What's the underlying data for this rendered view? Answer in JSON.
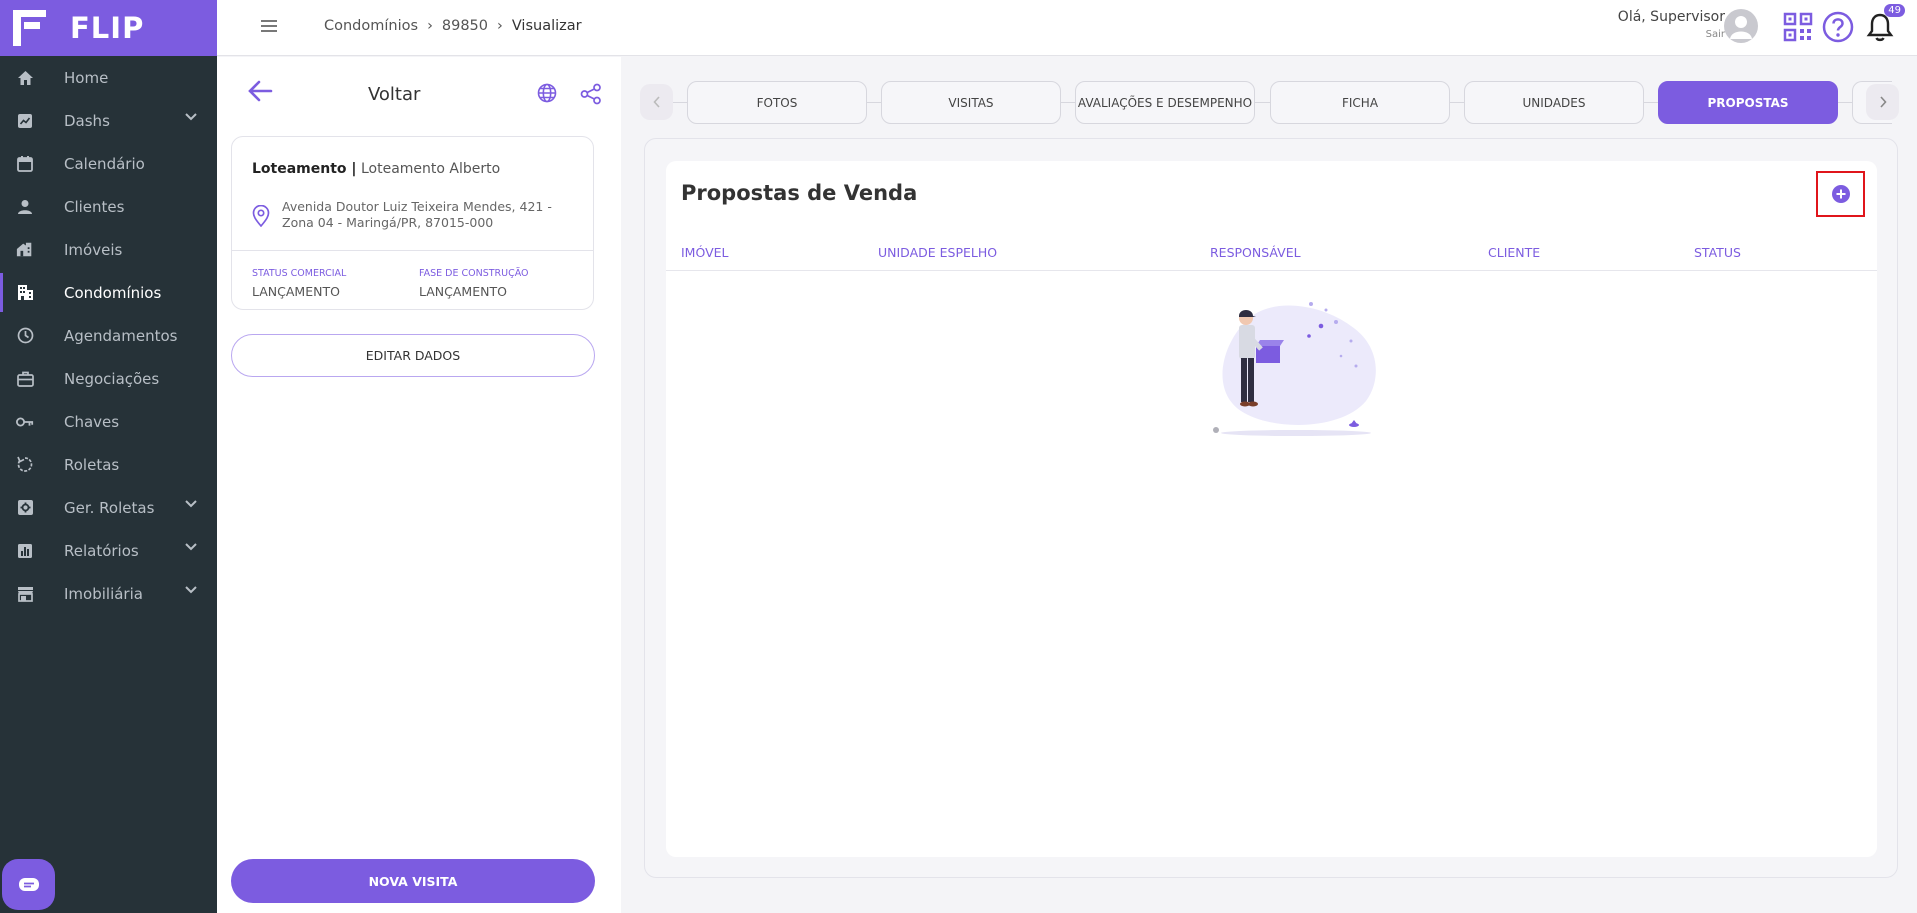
{
  "app": {
    "name": "FLIP"
  },
  "sidebar": {
    "items": [
      {
        "label": "Home",
        "icon": "home-icon",
        "chevron": false
      },
      {
        "label": "Dashs",
        "icon": "chart-icon",
        "chevron": true
      },
      {
        "label": "Calendário",
        "icon": "calendar-icon",
        "chevron": false
      },
      {
        "label": "Clientes",
        "icon": "person-icon",
        "chevron": false
      },
      {
        "label": "Imóveis",
        "icon": "building-icon",
        "chevron": false
      },
      {
        "label": "Condomínios",
        "icon": "condo-icon",
        "chevron": false,
        "active": true
      },
      {
        "label": "Agendamentos",
        "icon": "clock-icon",
        "chevron": false
      },
      {
        "label": "Negociações",
        "icon": "briefcase-icon",
        "chevron": false
      },
      {
        "label": "Chaves",
        "icon": "key-icon",
        "chevron": false
      },
      {
        "label": "Roletas",
        "icon": "rotate-icon",
        "chevron": false
      },
      {
        "label": "Ger. Roletas",
        "icon": "cog-box-icon",
        "chevron": true
      },
      {
        "label": "Relatórios",
        "icon": "report-icon",
        "chevron": true
      },
      {
        "label": "Imobiliária",
        "icon": "store-icon",
        "chevron": true
      }
    ]
  },
  "header": {
    "breadcrumb": [
      "Condomínios",
      "89850",
      "Visualizar"
    ],
    "greeting": "Olá, Supervisor",
    "logout": "Sair",
    "notifications": "49"
  },
  "left_panel": {
    "back_label": "Voltar",
    "type_label": "Loteamento |",
    "name": "Loteamento Alberto",
    "address": "Avenida Doutor Luiz Teixeira Mendes, 421 - Zona 04 - Maringá/PR, 87015-000",
    "status_label": "STATUS COMERCIAL",
    "status_value": "LANÇAMENTO",
    "phase_label": "FASE DE CONSTRUÇÃO",
    "phase_value": "LANÇAMENTO",
    "edit_button": "EDITAR DADOS",
    "new_visit_button": "NOVA VISITA"
  },
  "tabs": [
    {
      "label": "FOTOS"
    },
    {
      "label": "VISITAS"
    },
    {
      "label": "AVALIAÇÕES E DESEMPENHO"
    },
    {
      "label": "FICHA"
    },
    {
      "label": "UNIDADES"
    },
    {
      "label": "PROPOSTAS",
      "active": true
    }
  ],
  "main": {
    "title": "Propostas de Venda",
    "columns": [
      "IMÓVEL",
      "UNIDADE ESPELHO",
      "RESPONSÁVEL",
      "CLIENTE",
      "STATUS"
    ]
  },
  "colors": {
    "accent": "#7c5ce0",
    "sidebar": "#263238",
    "highlight": "#e0151b"
  }
}
